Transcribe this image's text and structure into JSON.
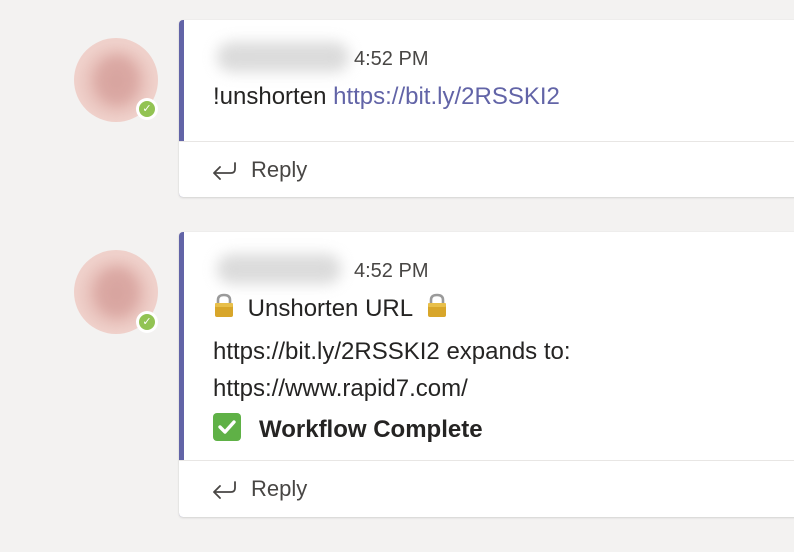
{
  "messages": [
    {
      "timestamp": "4:52 PM",
      "command_text": "!unshorten ",
      "link_text": "https://bit.ly/2RSSKI2",
      "reply_label": "Reply"
    },
    {
      "timestamp": "4:52 PM",
      "title": "Unshorten URL",
      "expand_line": "https://bit.ly/2RSSKI2 expands to:",
      "result_url": "https://www.rapid7.com/",
      "status": "Workflow Complete",
      "reply_label": "Reply"
    }
  ],
  "colors": {
    "accent": "#6264a7",
    "presence": "#92c353",
    "check": "#5fb146",
    "background": "#f3f2f1"
  },
  "icons": {
    "presence": "available-check-icon",
    "reply": "reply-arrow-icon",
    "lock": "lock-icon",
    "status": "check-mark-button-icon"
  }
}
